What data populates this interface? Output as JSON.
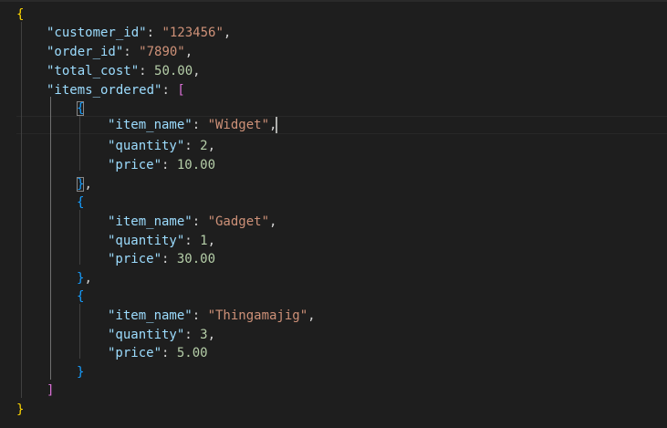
{
  "editor": {
    "language": "json",
    "lines": [
      {
        "tokens": [
          {
            "t": "{",
            "c": "b-gold"
          }
        ]
      },
      {
        "tokens": [
          {
            "t": "\"customer_id\"",
            "c": "key"
          },
          {
            "t": ": ",
            "c": "punc"
          },
          {
            "t": "\"123456\"",
            "c": "str"
          },
          {
            "t": ",",
            "c": "punc"
          }
        ]
      },
      {
        "tokens": [
          {
            "t": "\"order_id\"",
            "c": "key"
          },
          {
            "t": ": ",
            "c": "punc"
          },
          {
            "t": "\"7890\"",
            "c": "str"
          },
          {
            "t": ",",
            "c": "punc"
          }
        ]
      },
      {
        "tokens": [
          {
            "t": "\"total_cost\"",
            "c": "key"
          },
          {
            "t": ": ",
            "c": "punc"
          },
          {
            "t": "50.00",
            "c": "num"
          },
          {
            "t": ",",
            "c": "punc"
          }
        ]
      },
      {
        "tokens": [
          {
            "t": "\"items_ordered\"",
            "c": "key"
          },
          {
            "t": ": ",
            "c": "punc"
          },
          {
            "t": "[",
            "c": "b-pink"
          }
        ]
      },
      {
        "tokens": [
          {
            "t": "{",
            "c": "b-blue"
          }
        ]
      },
      {
        "tokens": [
          {
            "t": "\"item_name\"",
            "c": "key"
          },
          {
            "t": ": ",
            "c": "punc"
          },
          {
            "t": "\"Widget\"",
            "c": "str"
          },
          {
            "t": ",",
            "c": "punc"
          }
        ]
      },
      {
        "tokens": [
          {
            "t": "\"quantity\"",
            "c": "key"
          },
          {
            "t": ": ",
            "c": "punc"
          },
          {
            "t": "2",
            "c": "num"
          },
          {
            "t": ",",
            "c": "punc"
          }
        ]
      },
      {
        "tokens": [
          {
            "t": "\"price\"",
            "c": "key"
          },
          {
            "t": ": ",
            "c": "punc"
          },
          {
            "t": "10.00",
            "c": "num"
          }
        ]
      },
      {
        "tokens": [
          {
            "t": "}",
            "c": "b-blue"
          },
          {
            "t": ",",
            "c": "punc"
          }
        ]
      },
      {
        "tokens": [
          {
            "t": "{",
            "c": "b-blue"
          }
        ]
      },
      {
        "tokens": [
          {
            "t": "\"item_name\"",
            "c": "key"
          },
          {
            "t": ": ",
            "c": "punc"
          },
          {
            "t": "\"Gadget\"",
            "c": "str"
          },
          {
            "t": ",",
            "c": "punc"
          }
        ]
      },
      {
        "tokens": [
          {
            "t": "\"quantity\"",
            "c": "key"
          },
          {
            "t": ": ",
            "c": "punc"
          },
          {
            "t": "1",
            "c": "num"
          },
          {
            "t": ",",
            "c": "punc"
          }
        ]
      },
      {
        "tokens": [
          {
            "t": "\"price\"",
            "c": "key"
          },
          {
            "t": ": ",
            "c": "punc"
          },
          {
            "t": "30.00",
            "c": "num"
          }
        ]
      },
      {
        "tokens": [
          {
            "t": "}",
            "c": "b-blue"
          },
          {
            "t": ",",
            "c": "punc"
          }
        ]
      },
      {
        "tokens": [
          {
            "t": "{",
            "c": "b-blue"
          }
        ]
      },
      {
        "tokens": [
          {
            "t": "\"item_name\"",
            "c": "key"
          },
          {
            "t": ": ",
            "c": "punc"
          },
          {
            "t": "\"Thingamajig\"",
            "c": "str"
          },
          {
            "t": ",",
            "c": "punc"
          }
        ]
      },
      {
        "tokens": [
          {
            "t": "\"quantity\"",
            "c": "key"
          },
          {
            "t": ": ",
            "c": "punc"
          },
          {
            "t": "3",
            "c": "num"
          },
          {
            "t": ",",
            "c": "punc"
          }
        ]
      },
      {
        "tokens": [
          {
            "t": "\"price\"",
            "c": "key"
          },
          {
            "t": ": ",
            "c": "punc"
          },
          {
            "t": "5.00",
            "c": "num"
          }
        ]
      },
      {
        "tokens": [
          {
            "t": "}",
            "c": "b-blue"
          }
        ]
      },
      {
        "tokens": [
          {
            "t": "]",
            "c": "b-pink"
          }
        ]
      },
      {
        "tokens": [
          {
            "t": "}",
            "c": "b-gold"
          }
        ]
      }
    ]
  },
  "colors": {
    "background": "#1e1e1e",
    "key": "#9cdcfe",
    "string": "#ce9178",
    "number": "#b5cea8",
    "bracket_level1": "#ffd700",
    "bracket_level2": "#da70d6",
    "bracket_level3": "#179fff"
  }
}
